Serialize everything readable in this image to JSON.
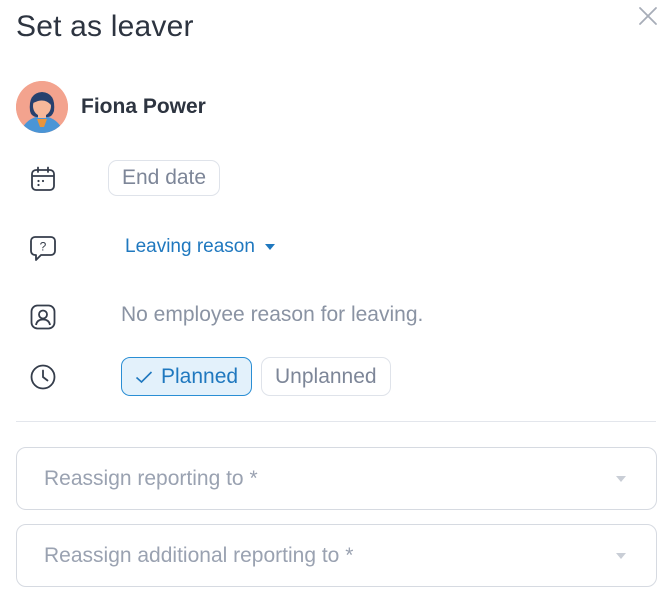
{
  "dialog": {
    "title": "Set as leaver",
    "close_icon": "close-icon"
  },
  "employee": {
    "name": "Fiona Power",
    "avatar_icon": "avatar-illustration"
  },
  "fields": {
    "end_date": {
      "icon": "calendar-icon",
      "placeholder": "End date"
    },
    "leaving_reason": {
      "icon": "question-bubble-icon",
      "label": "Leaving reason"
    },
    "employee_reason": {
      "icon": "person-badge-icon",
      "text": "No employee reason for leaving."
    },
    "leave_type": {
      "icon": "clock-icon",
      "options": [
        "Planned",
        "Unplanned"
      ],
      "selected": "Planned"
    }
  },
  "reassign": {
    "reporting_placeholder": "Reassign reporting to *",
    "additional_placeholder": "Reassign additional reporting to *"
  },
  "colors": {
    "accent": "#1f78bf",
    "selected_bg": "#e3f1fb",
    "muted_text": "#8a93a3"
  }
}
